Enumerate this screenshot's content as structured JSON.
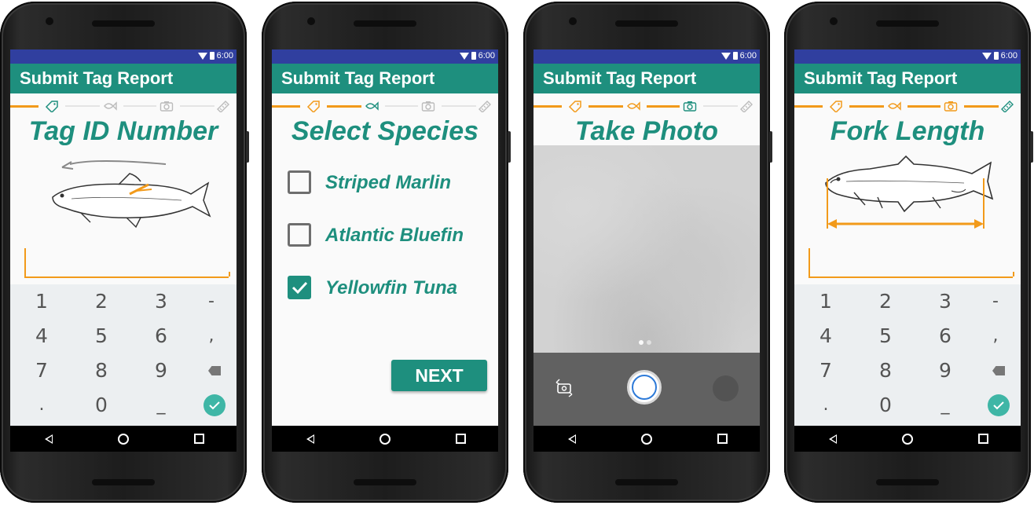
{
  "status": {
    "time": "6:00"
  },
  "app": {
    "title": "Submit Tag Report"
  },
  "steps": {
    "tag_id": {
      "title": "Tag ID Number"
    },
    "species": {
      "title": "Select Species",
      "options": [
        {
          "label": "Striped Marlin",
          "checked": false
        },
        {
          "label": "Atlantic Bluefin",
          "checked": false
        },
        {
          "label": "Yellowfin Tuna",
          "checked": true
        }
      ],
      "next_label": "NEXT"
    },
    "photo": {
      "title": "Take Photo",
      "page_dots": 2,
      "active_dot": 1
    },
    "length": {
      "title": "Fork Length"
    }
  },
  "keypad": {
    "rows": [
      [
        "1",
        "2",
        "3",
        "-"
      ],
      [
        "4",
        "5",
        "6",
        ","
      ],
      [
        "7",
        "8",
        "9",
        "backspace-icon"
      ],
      [
        ".",
        "0",
        "_",
        "done-check-icon"
      ]
    ]
  },
  "colors": {
    "accent": "#1e8f7e",
    "orange": "#f29a1a",
    "statusbar": "#303f9f"
  },
  "progress_icons": [
    "tag-icon",
    "fish-icon",
    "camera-icon",
    "ruler-icon"
  ]
}
